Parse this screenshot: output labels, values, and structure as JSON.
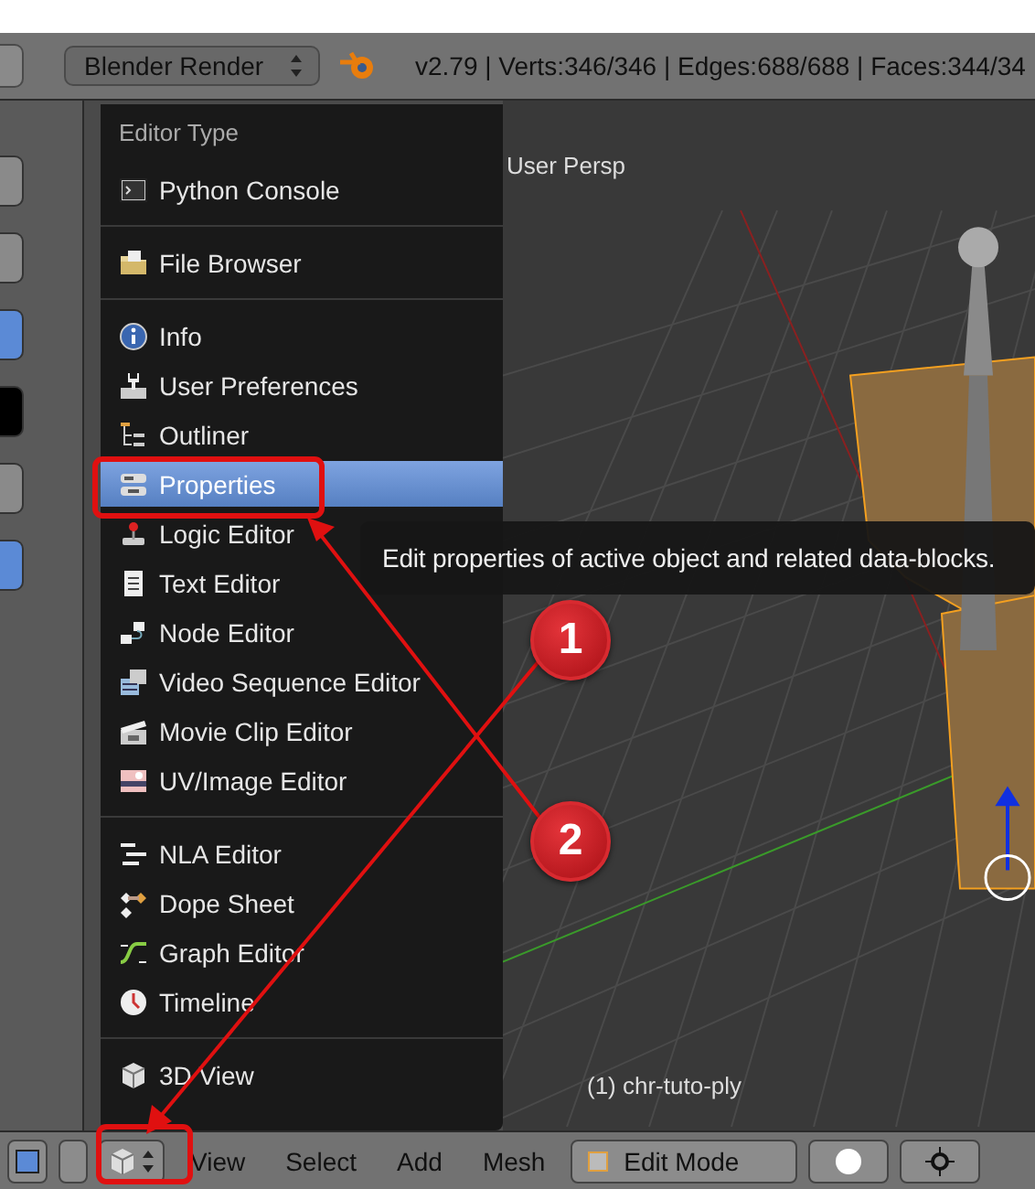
{
  "info_header": {
    "render_engine": "Blender Render",
    "stats": "v2.79 | Verts:346/346 | Edges:688/688 | Faces:344/34"
  },
  "viewport": {
    "view_name": "User Persp",
    "object_label": "(1) chr-tuto-ply"
  },
  "editor_menu": {
    "title": "Editor Type",
    "groups": [
      [
        {
          "label": "Python Console",
          "selected": false
        }
      ],
      [
        {
          "label": "File Browser",
          "selected": false
        }
      ],
      [
        {
          "label": "Info",
          "selected": false
        },
        {
          "label": "User Preferences",
          "selected": false
        },
        {
          "label": "Outliner",
          "selected": false
        },
        {
          "label": "Properties",
          "selected": true
        },
        {
          "label": "Logic Editor",
          "selected": false
        },
        {
          "label": "Text Editor",
          "selected": false
        },
        {
          "label": "Node Editor",
          "selected": false
        },
        {
          "label": "Video Sequence Editor",
          "selected": false
        },
        {
          "label": "Movie Clip Editor",
          "selected": false
        },
        {
          "label": "UV/Image Editor",
          "selected": false
        }
      ],
      [
        {
          "label": "NLA Editor",
          "selected": false
        },
        {
          "label": "Dope Sheet",
          "selected": false
        },
        {
          "label": "Graph Editor",
          "selected": false
        },
        {
          "label": "Timeline",
          "selected": false
        }
      ],
      [
        {
          "label": "3D View",
          "selected": false
        }
      ]
    ]
  },
  "tooltip": "Edit properties of active object and related data-blocks.",
  "view_header": {
    "menus": [
      "View",
      "Select",
      "Add",
      "Mesh"
    ],
    "mode": "Edit Mode"
  },
  "annotations": [
    {
      "label": "1"
    },
    {
      "label": "2"
    }
  ]
}
